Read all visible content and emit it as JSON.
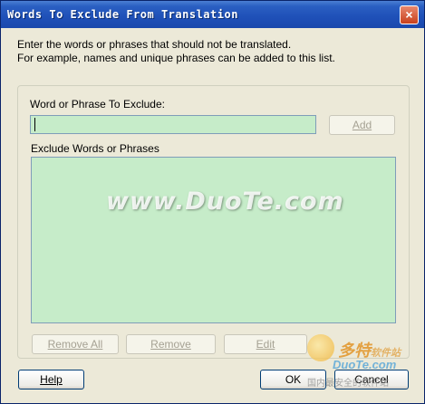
{
  "window": {
    "title": "Words To Exclude From Translation",
    "close_symbol": "×"
  },
  "description": {
    "line1": "Enter the words or phrases that should not be translated.",
    "line2": "For example, names and unique phrases can be added to this list."
  },
  "form": {
    "phrase_label": "Word or Phrase To Exclude:",
    "phrase_value": "",
    "list_label": "Exclude Words or Phrases",
    "list_items": []
  },
  "buttons": {
    "add": "Add",
    "remove_all": "Remove All",
    "remove": "Remove",
    "edit": "Edit",
    "help": "Help",
    "ok": "OK",
    "cancel": "Cancel"
  },
  "watermark": {
    "site": "www.DuoTe.com",
    "logo_main": "多特",
    "logo_small": "软件站",
    "logo_url": "DuoTe.com",
    "logo_tagline": "国内最安全的软件站"
  },
  "colors": {
    "titlebar": "#1f50b8",
    "input_bg": "#c6ecc9",
    "dialog_bg": "#ece9d8"
  }
}
